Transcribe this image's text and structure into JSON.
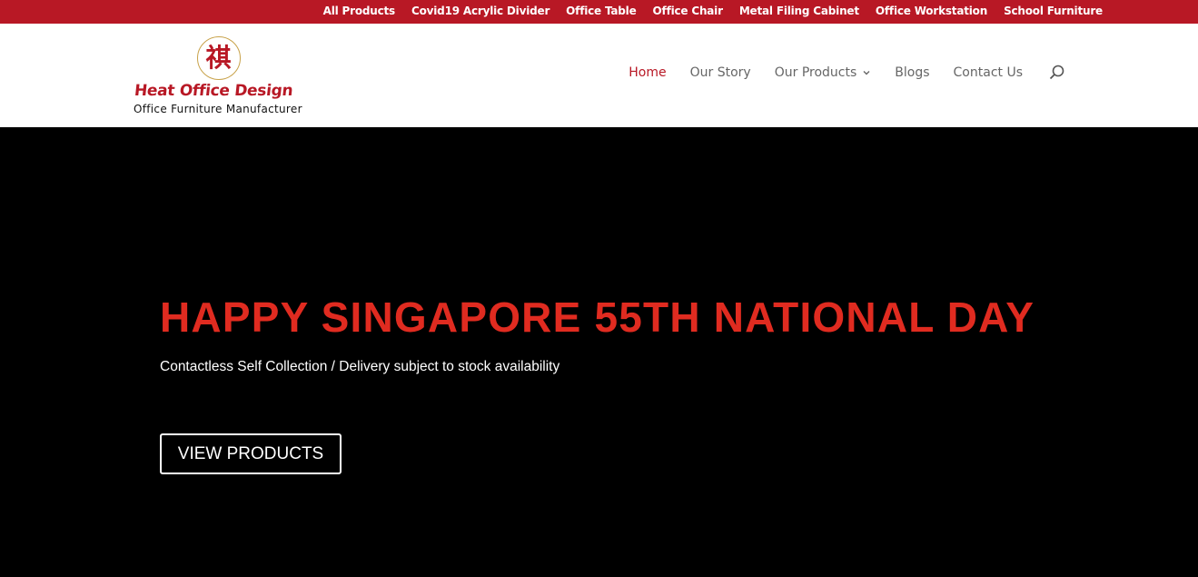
{
  "top_menu": {
    "items": [
      {
        "label": "All Products"
      },
      {
        "label": "Covid19 Acrylic Divider"
      },
      {
        "label": "Office Table"
      },
      {
        "label": "Office Chair"
      },
      {
        "label": "Metal Filing Cabinet"
      },
      {
        "label": "Office Workstation"
      },
      {
        "label": "School Furniture"
      }
    ]
  },
  "logo": {
    "emblem_char": "祺",
    "name": "Heat Office Design",
    "tagline": "Office Furniture Manufacturer"
  },
  "main_nav": {
    "items": [
      {
        "label": "Home",
        "active": true
      },
      {
        "label": "Our Story"
      },
      {
        "label": "Our Products",
        "has_dropdown": true
      },
      {
        "label": "Blogs"
      },
      {
        "label": "Contact Us"
      }
    ],
    "search_icon": "search-icon"
  },
  "hero": {
    "title": "HAPPY SINGAPORE 55TH NATIONAL DAY",
    "subtitle": "Contactless Self Collection / Delivery subject to stock availability",
    "button_label": "VIEW PRODUCTS"
  },
  "colors": {
    "brand_red": "#b81825",
    "hero_title_red": "#e02b20",
    "hero_background": "#000000",
    "nav_text": "#666666"
  }
}
